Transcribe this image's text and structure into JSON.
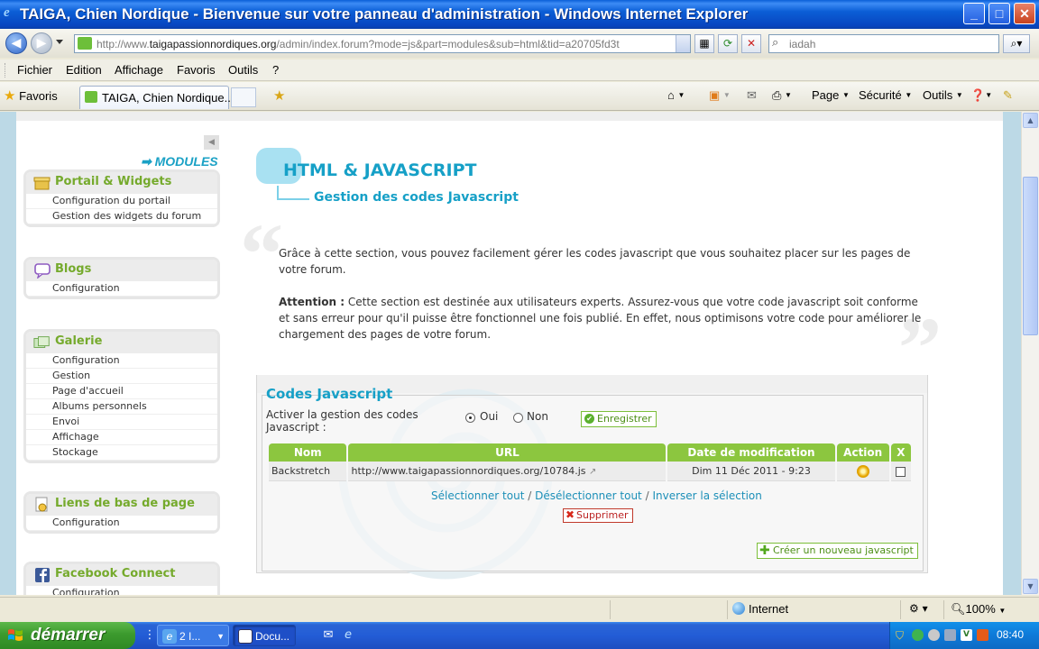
{
  "window": {
    "title": "TAIGA, Chien Nordique - Bienvenue sur votre panneau d'administration - Windows Internet Explorer",
    "minimize": "_",
    "maximize": "□",
    "close": "✕"
  },
  "address": {
    "url_prefix": "http://www.",
    "url_domain": "taigapassionnordiques.org",
    "url_path": "/admin/index.forum?mode=js&part=modules&sub=html&tid=a20705fd3t",
    "search_placeholder": "iadah"
  },
  "menu": [
    "Fichier",
    "Edition",
    "Affichage",
    "Favoris",
    "Outils",
    "?"
  ],
  "tabbar": {
    "favorites": "Favoris",
    "tab_title": "TAIGA, Chien Nordique...",
    "cmd_page": "Page",
    "cmd_security": "Sécurité",
    "cmd_tools": "Outils"
  },
  "sidebar": {
    "modules_label": "➡ MODULES",
    "groups": [
      {
        "title": "Portail & Widgets",
        "items": [
          "Configuration du portail",
          "Gestion des widgets du forum"
        ]
      },
      {
        "title": "Blogs",
        "items": [
          "Configuration"
        ]
      },
      {
        "title": "Galerie",
        "items": [
          "Configuration",
          "Gestion",
          "Page d'accueil",
          "Albums personnels",
          "Envoi",
          "Affichage",
          "Stockage"
        ]
      },
      {
        "title": "Liens de bas de page",
        "items": [
          "Configuration"
        ]
      },
      {
        "title": "Facebook Connect",
        "items": [
          "Configuration"
        ]
      }
    ]
  },
  "main": {
    "title": "HTML & JAVASCRIPT",
    "subtitle": "Gestion des codes Javascript",
    "intro": "Grâce à cette section, vous pouvez facilement gérer les codes javascript que vous souhaitez placer sur les pages de votre forum.",
    "attention_label": "Attention :",
    "attention_text": " Cette section est destinée aux utilisateurs experts. Assurez-vous que votre code javascript soit conforme et sans erreur pour qu'il puisse être fonctionnel une fois publié. En effet, nous optimisons votre code pour améliorer le chargement des pages de votre forum."
  },
  "codes": {
    "panel_title": "Codes Javascript",
    "activer_label": "Activer la gestion des codes Javascript :",
    "oui": "Oui",
    "non": "Non",
    "enable_selected": "Oui",
    "save_button": "Enregistrer",
    "columns": [
      "Nom",
      "URL",
      "Date de modification",
      "Action",
      "X"
    ],
    "rows": [
      {
        "nom": "Backstretch",
        "url": "http://www.taigapassionnordiques.org/10784.js",
        "date": "Dim 11 Déc 2011 - 9:23",
        "checked": false
      }
    ],
    "select_all": "Sélectionner tout",
    "deselect_all": "Désélectionner tout",
    "invert_selection": "Inverser la sélection",
    "delete_button": "Supprimer",
    "create_button": "Créer un nouveau javascript"
  },
  "status": {
    "zone": "Internet",
    "zoom": "100%"
  },
  "taskbar": {
    "start": "démarrer",
    "task_ie": "2 I...",
    "task_doc": "Docu...",
    "clock": "08:40"
  }
}
